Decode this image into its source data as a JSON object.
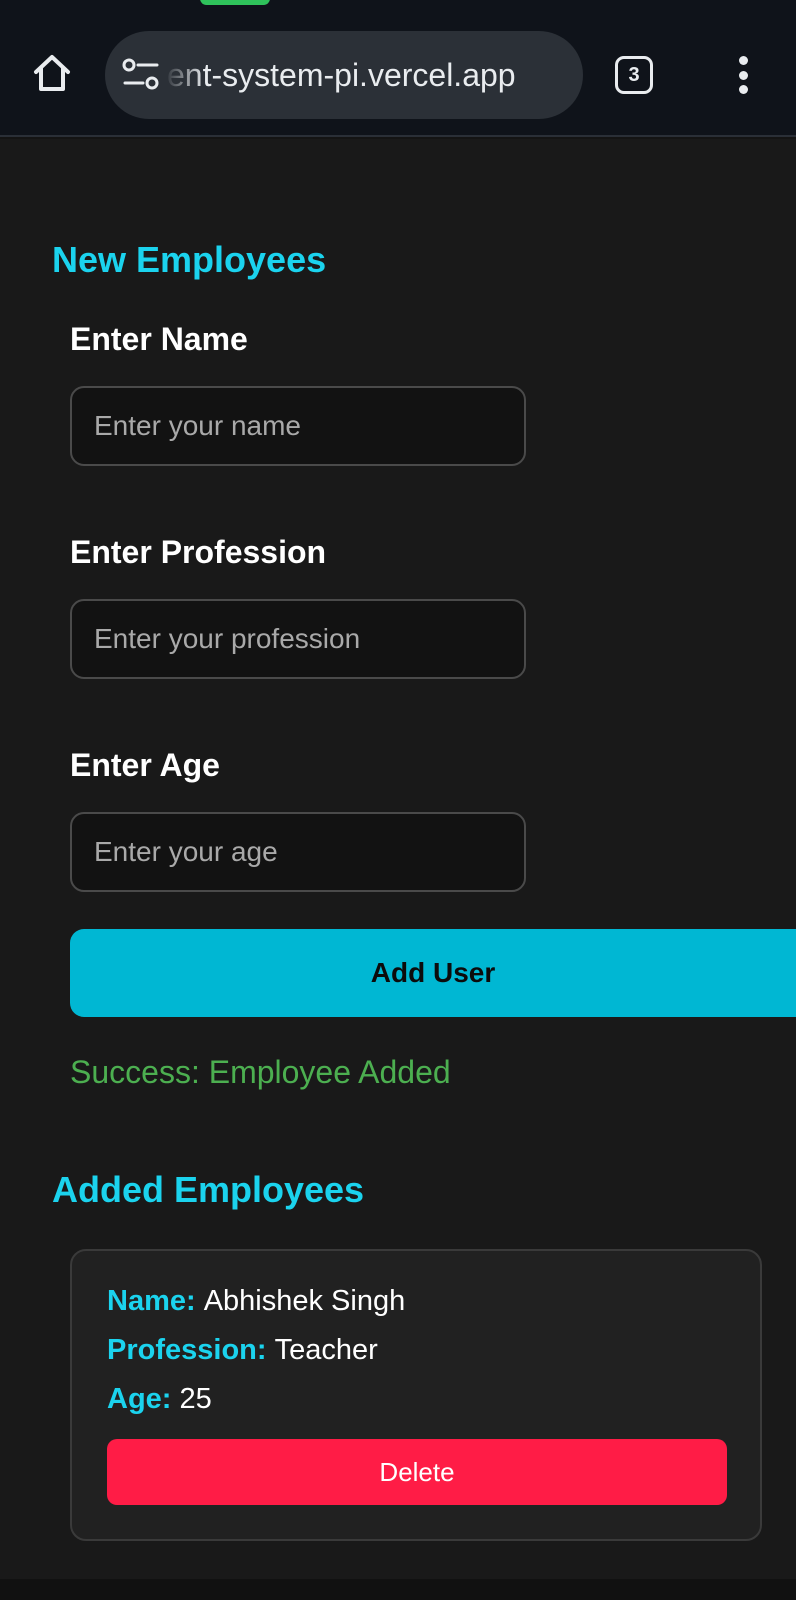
{
  "browser": {
    "url": "ent-system-pi.vercel.app",
    "tab_count": "3"
  },
  "form": {
    "title": "New Employees",
    "name_label": "Enter Name",
    "name_placeholder": "Enter your name",
    "profession_label": "Enter Profession",
    "profession_placeholder": "Enter your profession",
    "age_label": "Enter Age",
    "age_placeholder": "Enter your age",
    "submit_label": "Add User",
    "success_message": "Success: Employee Added"
  },
  "list": {
    "title": "Added Employees",
    "employees": [
      {
        "name_key": "Name:",
        "name": "Abhishek Singh",
        "profession_key": "Profession:",
        "profession": "Teacher",
        "age_key": "Age:",
        "age": "25",
        "delete_label": "Delete"
      }
    ]
  },
  "colors": {
    "accent": "#1bd3ee",
    "button": "#00b7d3",
    "success": "#4caf50",
    "danger": "#ff1c46",
    "background": "#191919"
  },
  "icons": [
    "home-icon",
    "site-settings-icon",
    "tab-switcher-icon",
    "more-vert-icon"
  ]
}
